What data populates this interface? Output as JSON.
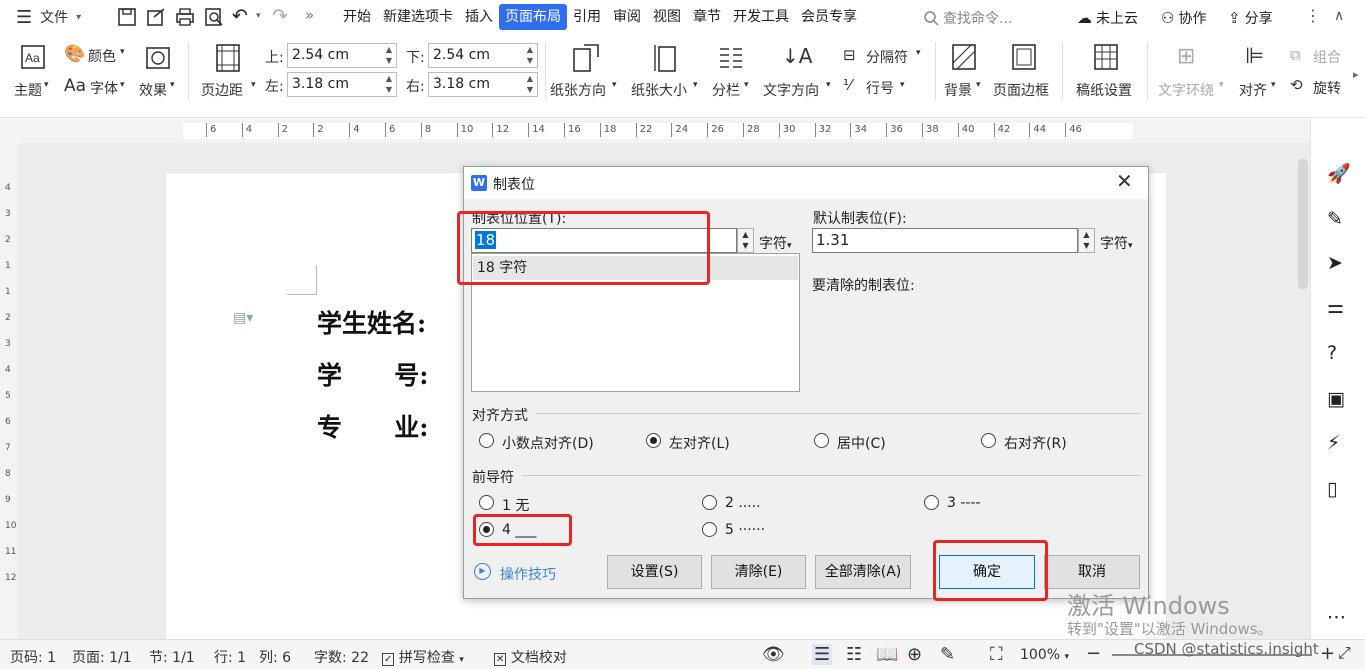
{
  "topbar": {
    "file_label": "文件",
    "tabs": [
      "开始",
      "新建选项卡",
      "插入",
      "页面布局",
      "引用",
      "审阅",
      "视图",
      "章节",
      "开发工具",
      "会员专享"
    ],
    "active_tab": "页面布局",
    "search_placeholder": "查找命令...",
    "cloud_label": "未上云",
    "collab_label": "协作",
    "share_label": "分享"
  },
  "ribbon": {
    "theme": "主题",
    "color": "颜色",
    "font": "字体",
    "effect": "效果",
    "margins": "页边距",
    "top_label": "上:",
    "top_value": "2.54 cm",
    "bottom_label": "下:",
    "bottom_value": "2.54 cm",
    "left_label": "左:",
    "left_value": "3.18 cm",
    "right_label": "右:",
    "right_value": "3.18 cm",
    "orientation": "纸张方向",
    "size": "纸张大小",
    "columns": "分栏",
    "text_direction": "文字方向",
    "breaks": "分隔符",
    "line_numbers": "行号",
    "background": "背景",
    "page_border": "页面边框",
    "grid_paper": "稿纸设置",
    "wrap": "文字环绕",
    "align": "对齐",
    "group": "组合",
    "rotate": "旋转"
  },
  "ruler_marks": [
    "6",
    "4",
    "2",
    "2",
    "4",
    "6",
    "8",
    "10",
    "12",
    "14",
    "16",
    "18",
    "22",
    "24",
    "26",
    "28",
    "30",
    "32",
    "34",
    "36",
    "38",
    "40",
    "42",
    "44",
    "46"
  ],
  "vruler_marks": [
    "4",
    "3",
    "2",
    "1",
    "1",
    "2",
    "3",
    "4",
    "5",
    "6",
    "7",
    "8",
    "9",
    "10",
    "11",
    "12"
  ],
  "document": {
    "line1": "学生姓名:",
    "line2": "学      号:",
    "line3": "专      业:"
  },
  "dialog": {
    "title": "制表位",
    "tab_position_label": "制表位位置(T):",
    "tab_position_value": "18",
    "tab_unit": "字符",
    "list_item": "18 字符",
    "default_label": "默认制表位(F):",
    "default_value": "1.31",
    "default_unit": "字符",
    "clear_label": "要清除的制表位:",
    "alignment_label": "对齐方式",
    "align_options": [
      "小数点对齐(D)",
      "左对齐(L)",
      "居中(C)",
      "右对齐(R)"
    ],
    "align_selected": 1,
    "leader_label": "前导符",
    "leader_options": [
      "1 无",
      "2 .....",
      "3 ----",
      "4 ___",
      "5 ······"
    ],
    "leader_selected": 3,
    "tips": "操作技巧",
    "buttons": {
      "set": "设置(S)",
      "clear": "清除(E)",
      "clear_all": "全部清除(A)",
      "ok": "确定",
      "cancel": "取消"
    }
  },
  "status": {
    "page_code": "页码: 1",
    "page": "页面: 1/1",
    "section": "节: 1/1",
    "row": "行: 1",
    "col": "列: 6",
    "words": "字数: 22",
    "spell": "拼写检查",
    "proof": "文档校对",
    "zoom": "100%"
  },
  "watermark": {
    "line1": "激活 Windows",
    "line2": "转到\"设置\"以激活 Windows。",
    "credit": "CSDN @statistics.insight"
  },
  "colors": {
    "accent": "#2f6fed",
    "highlight": "#e82424",
    "selection": "#cde3f7"
  }
}
